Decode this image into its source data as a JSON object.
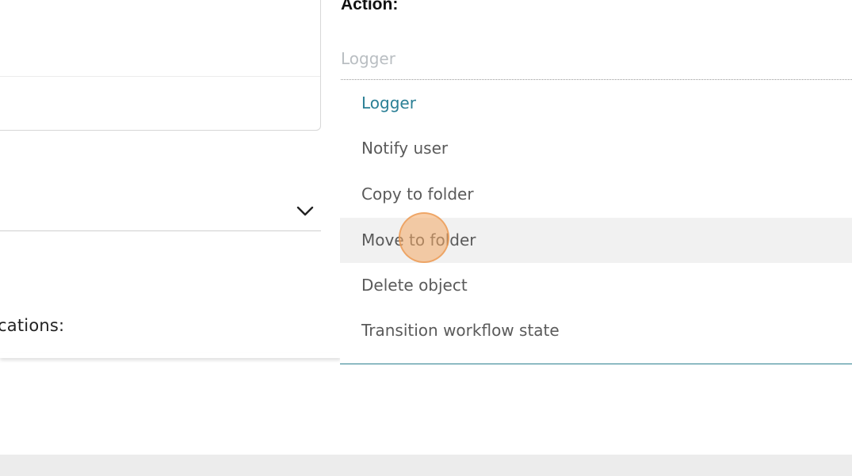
{
  "left": {
    "locations_label": "ocations:"
  },
  "action": {
    "label": "Action:",
    "current_value": "Logger",
    "options": [
      {
        "label": "Logger",
        "state": "selected"
      },
      {
        "label": "Notify user",
        "state": "normal"
      },
      {
        "label": "Copy to folder",
        "state": "normal"
      },
      {
        "label": "Move to folder",
        "state": "hover"
      },
      {
        "label": "Delete object",
        "state": "normal"
      },
      {
        "label": "Transition workflow state",
        "state": "normal"
      }
    ]
  },
  "icons": {
    "select_chevron": "chevron-down-icon"
  },
  "colors": {
    "selected_option": "#2a7f95",
    "hover_background": "#f1f1f1",
    "cursor_highlight": "#f3a865",
    "placeholder_text": "#b9bec2"
  }
}
